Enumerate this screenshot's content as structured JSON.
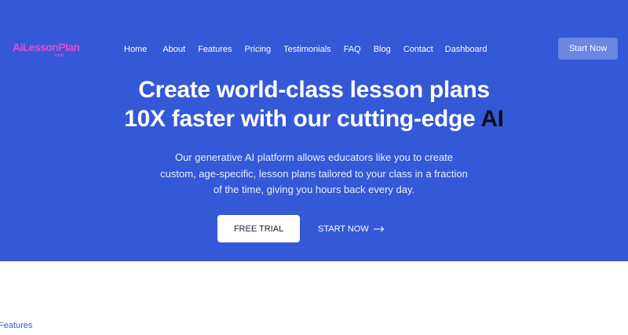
{
  "logo": {
    "main": "AiLessonPlan",
    "sub": "com"
  },
  "nav": {
    "items": [
      {
        "label": "Home"
      },
      {
        "label": "About"
      },
      {
        "label": "Features"
      },
      {
        "label": "Pricing"
      },
      {
        "label": "Testimonials"
      },
      {
        "label": "FAQ"
      },
      {
        "label": "Blog"
      },
      {
        "label": "Contact"
      },
      {
        "label": "Dashboard"
      }
    ],
    "cta_label": "Start Now"
  },
  "hero": {
    "headline_line1": "Create world-class lesson plans",
    "headline_line2": "10X faster with our cutting-edge ",
    "headline_accent": "AI",
    "subtext": "Our generative AI platform allows educators like you to create custom, age-specific, lesson plans tailored to your class in a fraction of the time, giving you hours back every day.",
    "primary_button": "FREE TRIAL",
    "secondary_link": "START NOW",
    "secondary_icon": "arrow-right-icon"
  },
  "features_section": {
    "label": "Features"
  },
  "colors": {
    "hero_bg": "#3558d6",
    "accent_text": "#0b0f1f",
    "logo": "#e04bd0",
    "cta_bg": "#6b86e3"
  }
}
